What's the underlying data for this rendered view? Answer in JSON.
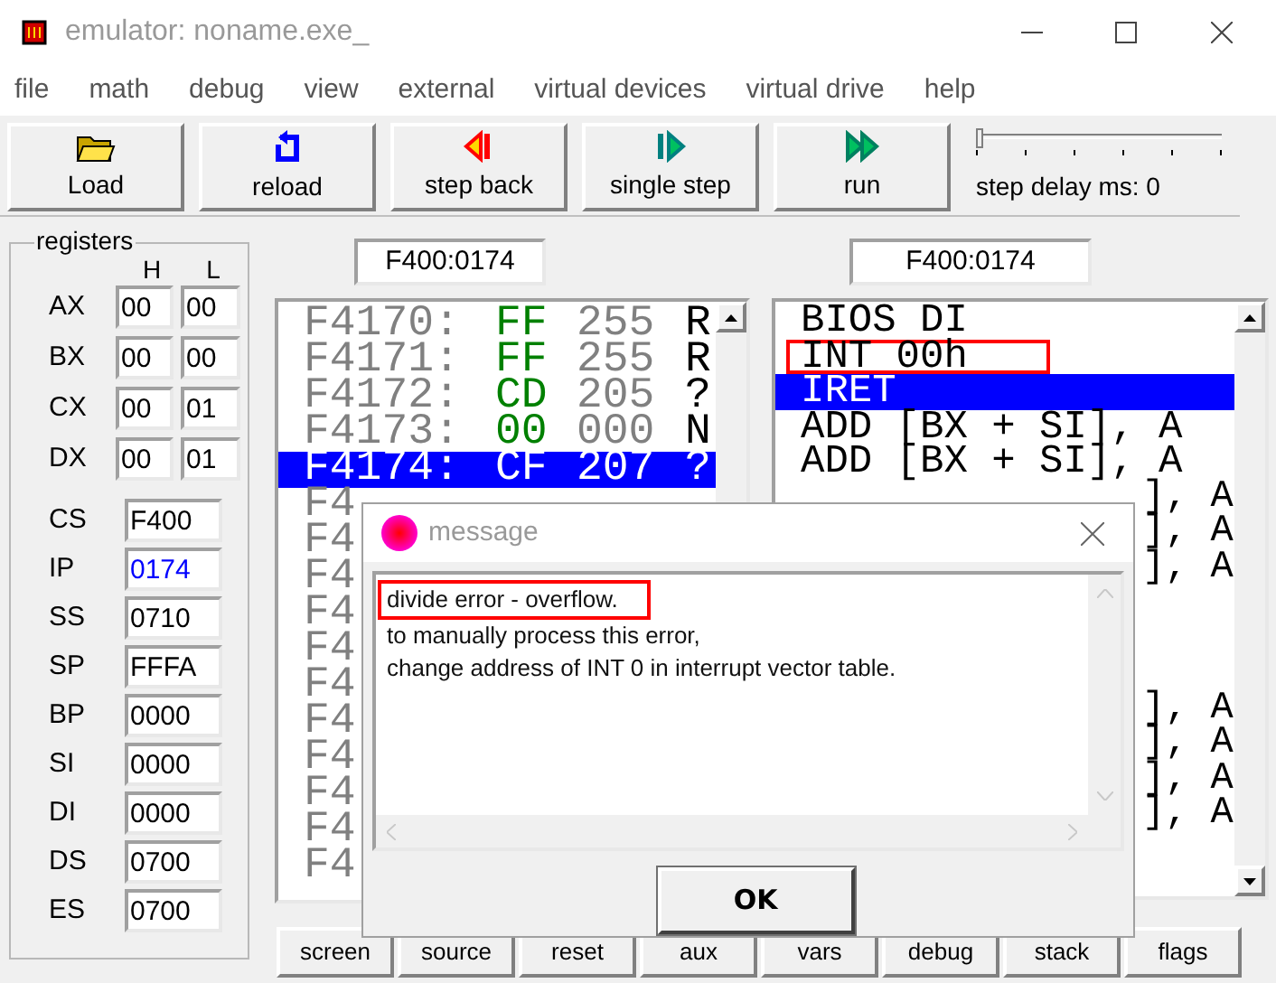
{
  "window": {
    "title": "emulator: noname.exe_"
  },
  "menu": [
    "file",
    "math",
    "debug",
    "view",
    "external",
    "virtual devices",
    "virtual drive",
    "help"
  ],
  "toolbar": [
    {
      "kind": "load",
      "label": "Load"
    },
    {
      "kind": "reload",
      "label": "reload"
    },
    {
      "kind": "back",
      "label": "step back"
    },
    {
      "kind": "step",
      "label": "single step"
    },
    {
      "kind": "run",
      "label": "run"
    }
  ],
  "step_delay": {
    "level": 0,
    "label": "step delay ms: 0"
  },
  "registers": {
    "title": "registers",
    "high_header": "H",
    "low_header": "L",
    "pairs": [
      {
        "name": "AX",
        "high": "00",
        "low": "00"
      },
      {
        "name": "BX",
        "high": "00",
        "low": "00"
      },
      {
        "name": "CX",
        "high": "00",
        "low": "01"
      },
      {
        "name": "DX",
        "high": "00",
        "low": "01"
      }
    ],
    "words": [
      {
        "name": "CS",
        "value": "F400",
        "changed": false
      },
      {
        "name": "IP",
        "value": "0174",
        "changed": true
      },
      {
        "name": "SS",
        "value": "0710",
        "changed": false
      },
      {
        "name": "SP",
        "value": "FFFA",
        "changed": false
      },
      {
        "name": "BP",
        "value": "0000",
        "changed": false
      },
      {
        "name": "SI",
        "value": "0000",
        "changed": false
      },
      {
        "name": "DI",
        "value": "0000",
        "changed": false
      },
      {
        "name": "DS",
        "value": "0700",
        "changed": false
      },
      {
        "name": "ES",
        "value": "0700",
        "changed": false
      }
    ]
  },
  "memory": {
    "address": "F400:0174",
    "rows": [
      {
        "address": "F4170:",
        "hex": "FF",
        "dec": "255",
        "char": "R",
        "selected": false
      },
      {
        "address": "F4171:",
        "hex": "FF",
        "dec": "255",
        "char": "R",
        "selected": false
      },
      {
        "address": "F4172:",
        "hex": "CD",
        "dec": "205",
        "char": "?",
        "selected": false
      },
      {
        "address": "F4173:",
        "hex": "00",
        "dec": "000",
        "char": "N",
        "selected": false
      },
      {
        "address": "F4174:",
        "hex": "CF",
        "dec": "207",
        "char": "?",
        "selected": true
      },
      {
        "address": "F4",
        "selected": false
      },
      {
        "address": "F4",
        "selected": false
      },
      {
        "address": "F4",
        "selected": false
      },
      {
        "address": "F4",
        "selected": false
      },
      {
        "address": "F4",
        "selected": false
      },
      {
        "address": "F4",
        "selected": false
      },
      {
        "address": "F4",
        "selected": false
      },
      {
        "address": "F4",
        "selected": false
      },
      {
        "address": "F4",
        "selected": false
      },
      {
        "address": "F4",
        "selected": false
      },
      {
        "address": "F4",
        "selected": false
      }
    ]
  },
  "disassembly": {
    "address": "F400:0174",
    "rows": [
      {
        "kind": "full",
        "text": "BIOS DI",
        "selected": false,
        "highlighted": false
      },
      {
        "kind": "full",
        "text": "INT 00h",
        "selected": false,
        "highlighted": true
      },
      {
        "kind": "full",
        "text": "IRET",
        "selected": true,
        "highlighted": false
      },
      {
        "kind": "full",
        "text": "ADD [BX + SI], A",
        "selected": false,
        "highlighted": false
      },
      {
        "kind": "full",
        "text": "ADD [BX + SI], A",
        "selected": false,
        "highlighted": false
      },
      {
        "kind": "tail",
        "text": "], A",
        "selected": false
      },
      {
        "kind": "tail",
        "text": "], A",
        "selected": false
      },
      {
        "kind": "tail",
        "text": "], A",
        "selected": false
      },
      {
        "kind": "covered",
        "selected": false
      },
      {
        "kind": "covered",
        "selected": false
      },
      {
        "kind": "covered",
        "selected": false
      },
      {
        "kind": "tail",
        "text": "], A",
        "selected": false
      },
      {
        "kind": "tail",
        "text": "], A",
        "selected": false
      },
      {
        "kind": "tail",
        "text": "], A",
        "selected": false
      },
      {
        "kind": "tail",
        "text": "], A",
        "selected": false
      }
    ]
  },
  "bottom_buttons": [
    "screen",
    "source",
    "reset",
    "aux",
    "vars",
    "debug",
    "stack",
    "flags"
  ],
  "dialog": {
    "title": "message",
    "lines": [
      {
        "text": "divide error - overflow.",
        "highlighted": true
      },
      {
        "text": "to manually process this error,",
        "highlighted": false
      },
      {
        "text": "change address of INT 0 in interrupt vector table.",
        "highlighted": false
      }
    ],
    "ok": "OK"
  }
}
